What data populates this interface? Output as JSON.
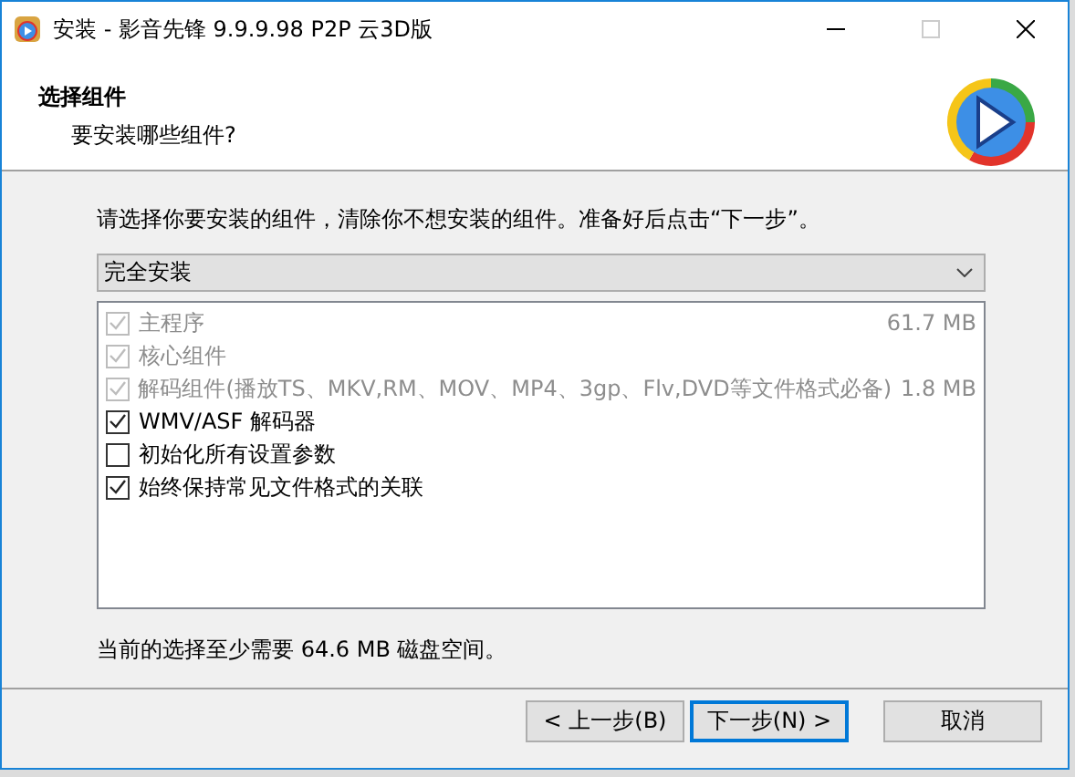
{
  "window": {
    "title": "安装 - 影音先锋 9.9.9.98 P2P 云3D版"
  },
  "header": {
    "title": "选择组件",
    "subtitle": "要安装哪些组件?"
  },
  "instruction": "请选择你要安装的组件，清除你不想安装的组件。准备好后点击“下一步”。",
  "install_type": {
    "value": "完全安装"
  },
  "components": [
    {
      "label": "主程序",
      "size": "61.7 MB",
      "checked": true,
      "disabled": true
    },
    {
      "label": "核心组件",
      "checked": true,
      "disabled": true
    },
    {
      "label": "解码组件(播放TS、MKV,RM、MOV、MP4、3gp、Flv,DVD等文件格式必备)",
      "size": "1.8 MB",
      "checked": true,
      "disabled": true
    },
    {
      "label": "WMV/ASF 解码器",
      "checked": true,
      "disabled": false
    },
    {
      "label": "初始化所有设置参数",
      "checked": false,
      "disabled": false
    },
    {
      "label": "始终保持常见文件格式的关联",
      "checked": true,
      "disabled": false
    }
  ],
  "disk_space": "当前的选择至少需要 64.6 MB 磁盘空间。",
  "buttons": [
    {
      "label": "< 上一步(B)",
      "selected": false
    },
    {
      "label": "下一步(N) >",
      "selected": true
    },
    {
      "label": "取消",
      "selected": false
    }
  ]
}
